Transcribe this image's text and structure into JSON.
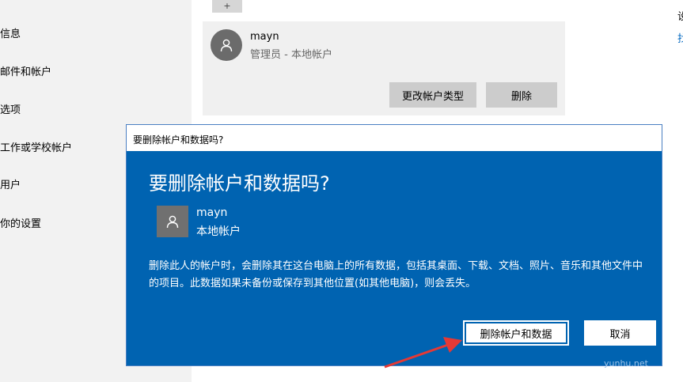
{
  "sidebar": {
    "items": [
      {
        "label": "信息"
      },
      {
        "label": "邮件和帐户"
      },
      {
        "label": "选项"
      },
      {
        "label": "工作或学校帐户"
      },
      {
        "label": "用户"
      },
      {
        "label": "你的设置"
      }
    ]
  },
  "top_add_button": {
    "label": "+"
  },
  "account_card": {
    "name": "mayn",
    "role": "管理员 - 本地帐户",
    "change_type_label": "更改帐户类型",
    "delete_label": "删除"
  },
  "right_hints": {
    "line1": "设",
    "line2": "找"
  },
  "dialog": {
    "title": "要删除帐户和数据吗?",
    "heading": "要删除帐户和数据吗?",
    "user_name": "mayn",
    "account_type": "本地帐户",
    "body": "删除此人的帐户时，会删除其在这台电脑上的所有数据，包括其桌面、下载、文档、照片、音乐和其他文件中的项目。此数据如果未备份或保存到其他位置(如其他电脑)，则会丢失。",
    "confirm_label": "删除帐户和数据",
    "cancel_label": "取消"
  },
  "watermark": "yunhu.net",
  "colors": {
    "dialog_bg": "#0063b1",
    "arrow": "#e53935",
    "sidebar_bg": "#f2f2f2"
  }
}
